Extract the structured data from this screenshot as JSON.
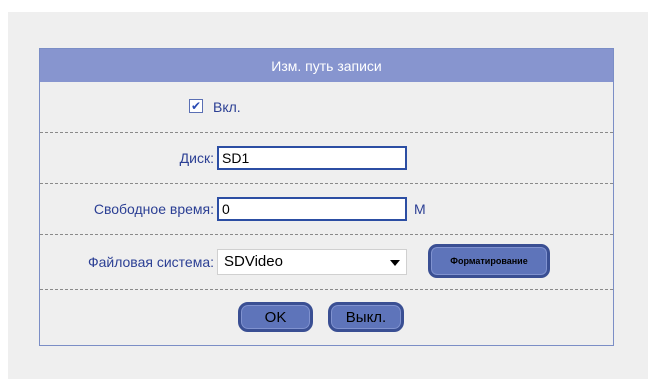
{
  "dialog": {
    "title": "Изм. путь записи",
    "enable": {
      "label": "Вкл.",
      "checked": true
    },
    "disk": {
      "label": "Диск:",
      "value": "SD1"
    },
    "free_time": {
      "label": "Свободное время:",
      "value": "0",
      "unit": "M"
    },
    "filesystem": {
      "label": "Файловая система:",
      "selected": "SDVideo",
      "format_button": "Форматирование"
    },
    "buttons": {
      "ok": "OK",
      "off": "Выкл."
    }
  },
  "colors": {
    "title_bar": "#8795cf",
    "label_text": "#2b3f94",
    "button_fill": "#5e74ba",
    "panel_bg": "#efefef"
  },
  "icons": {
    "checkbox": "checkmark-icon",
    "dropdown": "triangle-down-icon"
  }
}
